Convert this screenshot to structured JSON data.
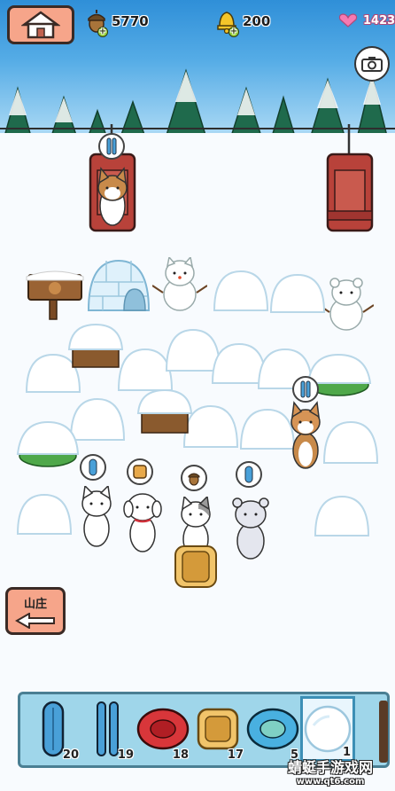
{
  "hud": {
    "acorns": "5770",
    "bells": "200",
    "hearts": "1423",
    "acorn_icon": "acorn-icon",
    "bell_icon": "bell-icon",
    "heart_icon": "heart-icon",
    "home_icon": "house-icon",
    "camera_icon": "camera-icon"
  },
  "navigation": {
    "lodge_label": "山庄",
    "lodge_icon": "arrow-left-icon"
  },
  "inventory": [
    {
      "item": "blue-sled",
      "count": "20"
    },
    {
      "item": "blue-skis",
      "count": "19"
    },
    {
      "item": "red-snow-tube",
      "count": "18"
    },
    {
      "item": "wooden-sled",
      "count": "17"
    },
    {
      "item": "blue-snow-tube",
      "count": "5"
    },
    {
      "item": "snowball",
      "count": "1",
      "selected": true
    }
  ],
  "watermark": {
    "title": "蜻蜓手游戏网",
    "url": "www.qt6.com"
  },
  "colors": {
    "sky": "#3a98dd",
    "button": "#f6a58a",
    "toolbar": "#9fd6ea",
    "pine": "#1f6a4c",
    "chair": "#b8423a"
  }
}
